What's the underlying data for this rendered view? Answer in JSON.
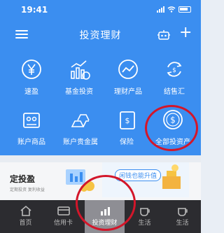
{
  "status_bar": {
    "time": "19:41"
  },
  "nav": {
    "title": "投资理财"
  },
  "grid": {
    "items": [
      {
        "label": "速盈",
        "icon": "yen-coin-icon"
      },
      {
        "label": "基金投资",
        "icon": "bar-chart-icon"
      },
      {
        "label": "理财产品",
        "icon": "trend-line-icon"
      },
      {
        "label": "结售汇",
        "icon": "exchange-icon"
      },
      {
        "label": "账户商品",
        "icon": "store-icon"
      },
      {
        "label": "账户贵金属",
        "icon": "gold-bar-icon"
      },
      {
        "label": "保险",
        "icon": "insurance-card-icon"
      },
      {
        "label": "全部投资产",
        "icon": "dollar-coin-icon"
      }
    ]
  },
  "promo": {
    "title": "定投盈",
    "subtitle": "定期投资 复利收益",
    "banner_text": "闲钱也能升值"
  },
  "tab_bar": {
    "tabs": [
      {
        "label": "首页",
        "icon": "home-icon"
      },
      {
        "label": "信用卡",
        "icon": "card-icon"
      },
      {
        "label": "投资理财",
        "icon": "chart-icon"
      },
      {
        "label": "生活",
        "icon": "coffee-icon"
      },
      {
        "label": "生活",
        "icon": "coffee-icon"
      }
    ],
    "active_index": 2
  },
  "colors": {
    "primary": "#3b8ef0",
    "highlight": "#d3162a",
    "tab_bg": "#2c2c30"
  }
}
